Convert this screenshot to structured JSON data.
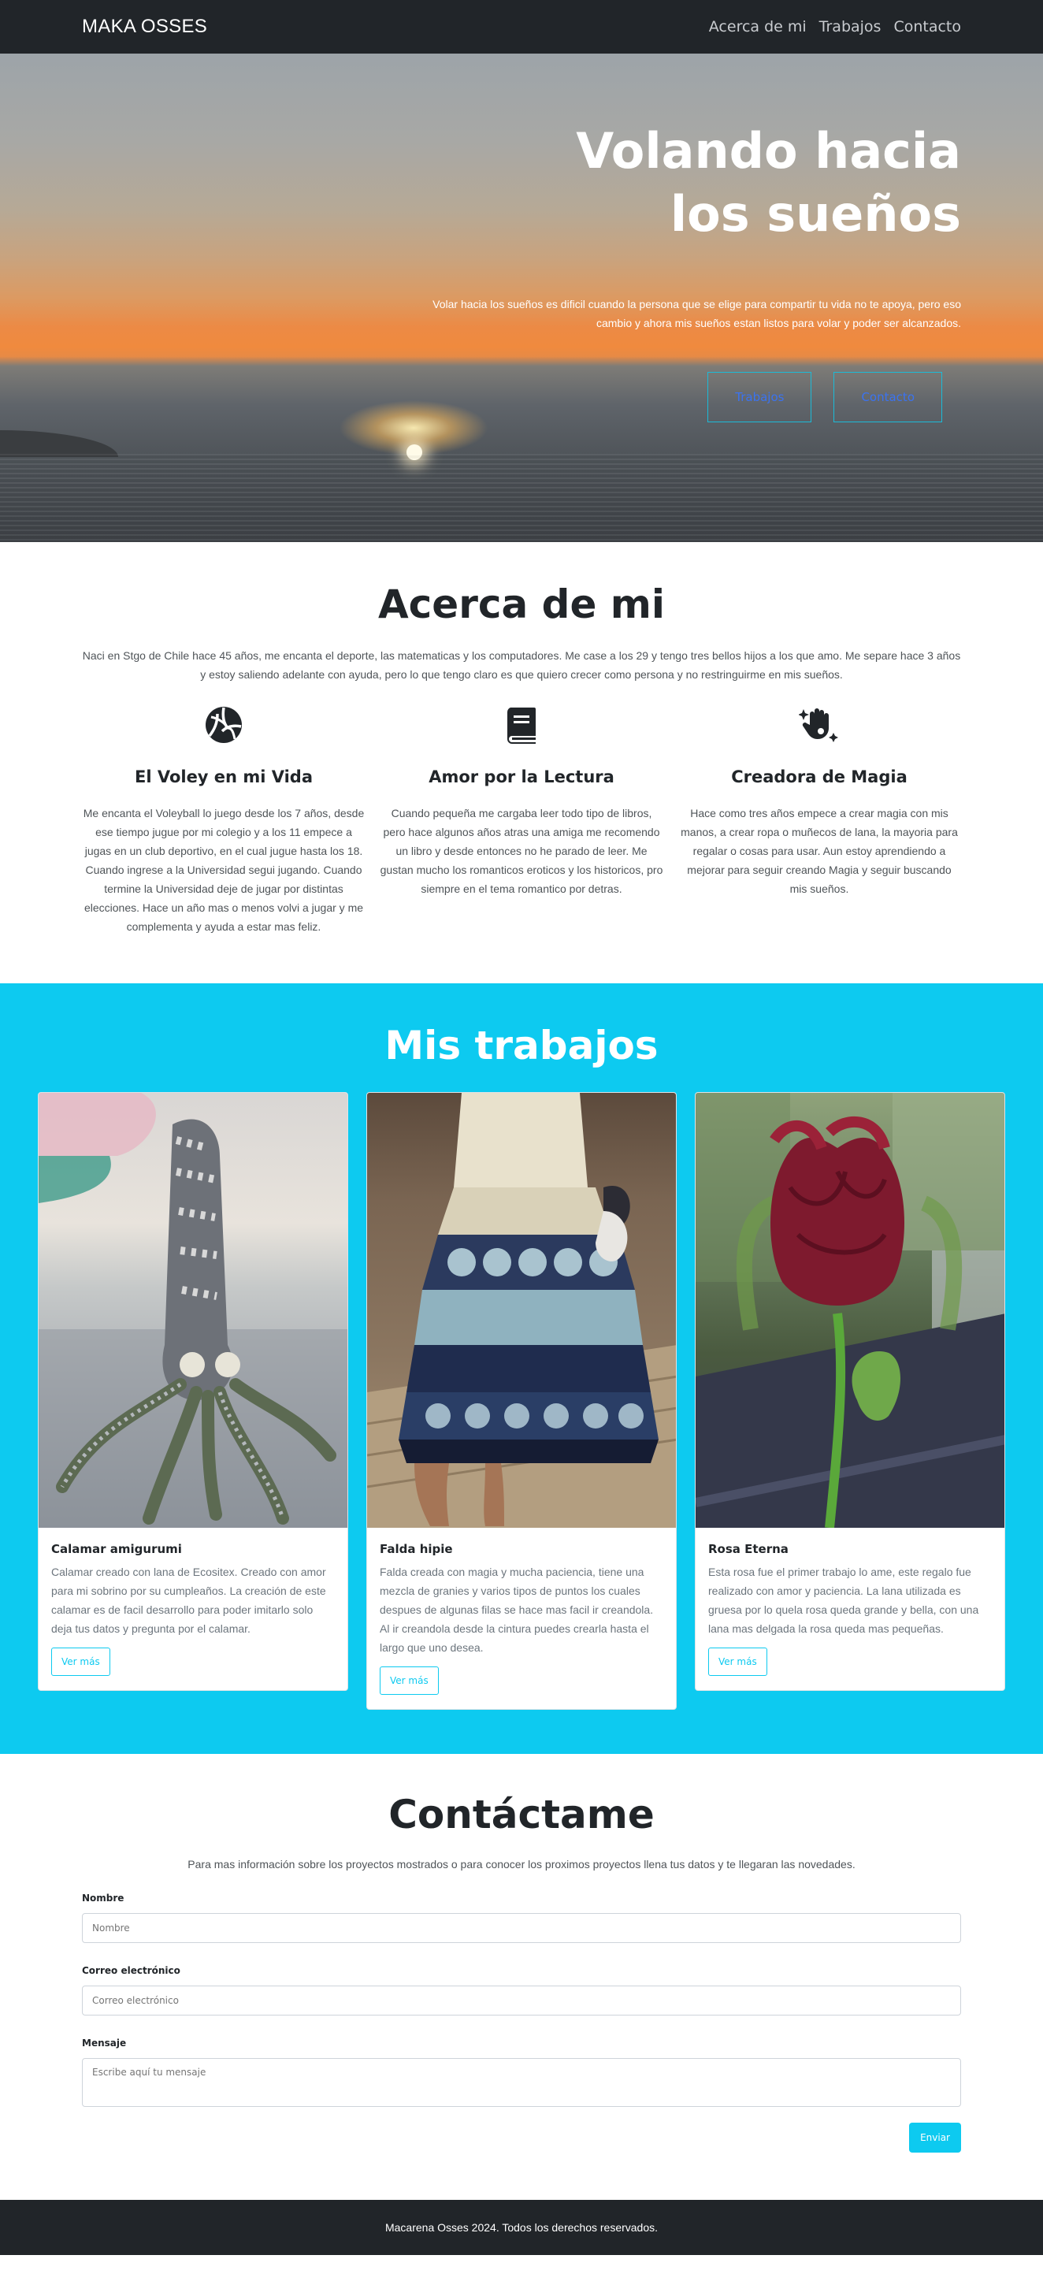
{
  "navbar": {
    "brand": "MAKA OSSES",
    "links": [
      "Acerca de mi",
      "Trabajos",
      "Contacto"
    ]
  },
  "hero": {
    "title_line1": "Volando hacia",
    "title_line2": "los sueños",
    "text": "Volar hacia los sueños es dificil cuando la persona que se elige para compartir tu vida no te apoya, pero eso cambio y ahora mis sueños estan listos para volar y poder ser alcanzados.",
    "buttons": [
      "Trabajos",
      "Contacto"
    ]
  },
  "about": {
    "title": "Acerca de mi",
    "lead": "Naci en Stgo de Chile hace 45 años, me encanta el deporte, las matematicas y los computadores. Me case a los 29 y tengo tres bellos hijos a los que amo. Me separe hace 3 años y estoy saliendo adelante con ayuda, pero lo que tengo claro es que quiero crecer como persona y no restringuirme en mis sueños.",
    "features": [
      {
        "icon": "volleyball-icon",
        "title": "El Voley en mi Vida",
        "text": "Me encanta el Voleyball lo juego desde los 7 años, desde ese tiempo jugue por mi colegio y a los 11 empece a jugas en un club deportivo, en el cual jugue hasta los 18. Cuando ingrese a la Universidad segui jugando. Cuando termine la Universidad deje de jugar por distintas elecciones. Hace un año mas o menos volvi a jugar y me complementa y ayuda a estar mas feliz."
      },
      {
        "icon": "book-icon",
        "title": "Amor por la Lectura",
        "text": "Cuando pequeña me cargaba leer todo tipo de libros, pero hace algunos años atras una amiga me recomendo un libro y desde entonces no he parado de leer. Me gustan mucho los romanticos eroticos y los historicos, pro siempre en el tema romantico por detras."
      },
      {
        "icon": "magic-hand-icon",
        "title": "Creadora de Magia",
        "text": "Hace como tres años empece a crear magia con mis manos, a crear ropa o muñecos de lana, la mayoria para regalar o cosas para usar. Aun estoy aprendiendo a mejorar para seguir creando Magia y seguir buscando mis sueños."
      }
    ]
  },
  "works": {
    "title": "Mis trabajos",
    "cards": [
      {
        "title": "Calamar amigurumi",
        "text": "Calamar creado con lana de Ecositex. Creado con amor para mi sobrino por su cumpleaños. La creación de este calamar es de facil desarrollo para poder imitarlo solo deja tus datos y pregunta por el calamar.",
        "button": "Ver más"
      },
      {
        "title": "Falda hipie",
        "text": "Falda creada con magia y mucha paciencia, tiene una mezcla de granies y varios tipos de puntos los cuales despues de algunas filas se hace mas facil ir creandola. Al ir creandola desde la cintura puedes crearla hasta el largo que uno desea.",
        "button": "Ver más"
      },
      {
        "title": "Rosa Eterna",
        "text": "Esta rosa fue el primer trabajo lo ame, este regalo fue realizado con amor y paciencia. La lana utilizada es gruesa por lo quela rosa queda grande y bella, con una lana mas delgada la rosa queda mas pequeñas.",
        "button": "Ver más"
      }
    ]
  },
  "contact": {
    "title": "Contáctame",
    "lead": "Para mas información sobre los proyectos mostrados o para conocer los proximos proyectos llena tus datos y te llegaran las novedades.",
    "name_label": "Nombre",
    "name_placeholder": "Nombre",
    "email_label": "Correo electrónico",
    "email_placeholder": "Correo electrónico",
    "message_label": "Mensaje",
    "message_placeholder": "Escribe aquí tu mensaje",
    "submit": "Enviar"
  },
  "footer": {
    "text": "Macarena Osses 2024. Todos los derechos reservados."
  },
  "colors": {
    "navbar": "#212529",
    "accent": "#0dcaf0",
    "hero_button_text": "#3b73f0"
  }
}
